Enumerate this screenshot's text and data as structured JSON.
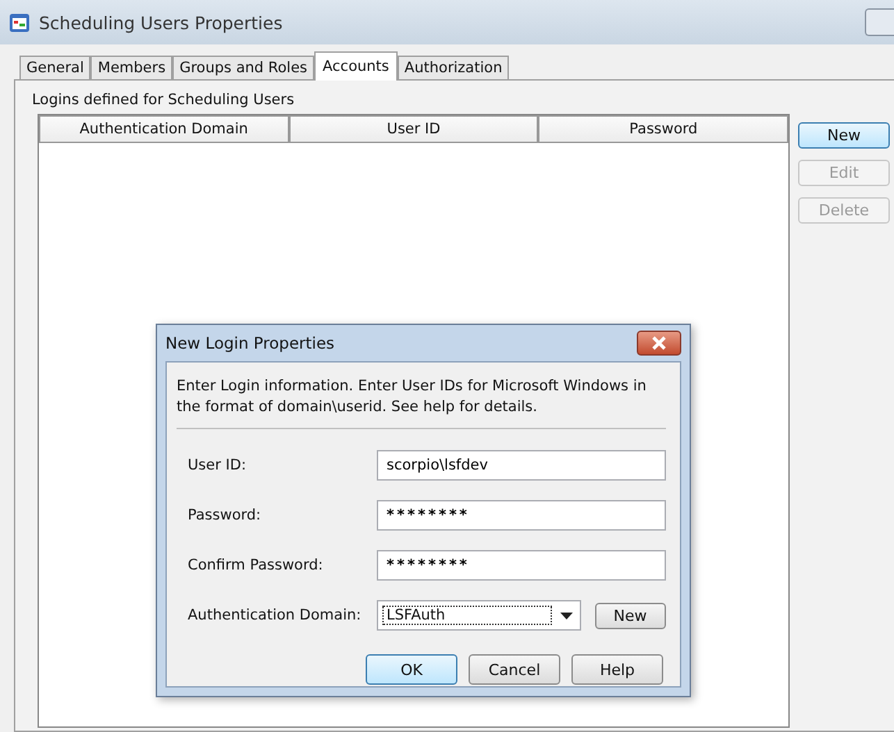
{
  "window": {
    "title": "Scheduling Users Properties"
  },
  "tabs": [
    {
      "label": "General",
      "selected": false
    },
    {
      "label": "Members",
      "selected": false
    },
    {
      "label": "Groups and Roles",
      "selected": false
    },
    {
      "label": "Accounts",
      "selected": true
    },
    {
      "label": "Authorization",
      "selected": false
    }
  ],
  "group": {
    "title": "Logins defined for Scheduling Users"
  },
  "table": {
    "columns": [
      "Authentication Domain",
      "User ID",
      "Password"
    ]
  },
  "side_buttons": [
    {
      "label": "New",
      "disabled": false,
      "default": true
    },
    {
      "label": "Edit",
      "disabled": true,
      "default": false
    },
    {
      "label": "Delete",
      "disabled": true,
      "default": false
    }
  ],
  "dialog": {
    "title": "New Login Properties",
    "description": "Enter Login information. Enter User IDs for Microsoft Windows in the format of domain\\userid. See help for details.",
    "fields": [
      {
        "kind": "text",
        "label": "User ID:",
        "value": "scorpio\\lsfdev"
      },
      {
        "kind": "password",
        "label": "Password:",
        "value": "********"
      },
      {
        "kind": "password",
        "label": "Confirm Password:",
        "value": "********"
      },
      {
        "kind": "select",
        "label": "Authentication Domain:",
        "value": "LSFAuth",
        "button": "New"
      }
    ],
    "buttons": [
      {
        "label": "OK",
        "default": true
      },
      {
        "label": "Cancel",
        "default": false
      },
      {
        "label": "Help",
        "default": false
      }
    ]
  }
}
